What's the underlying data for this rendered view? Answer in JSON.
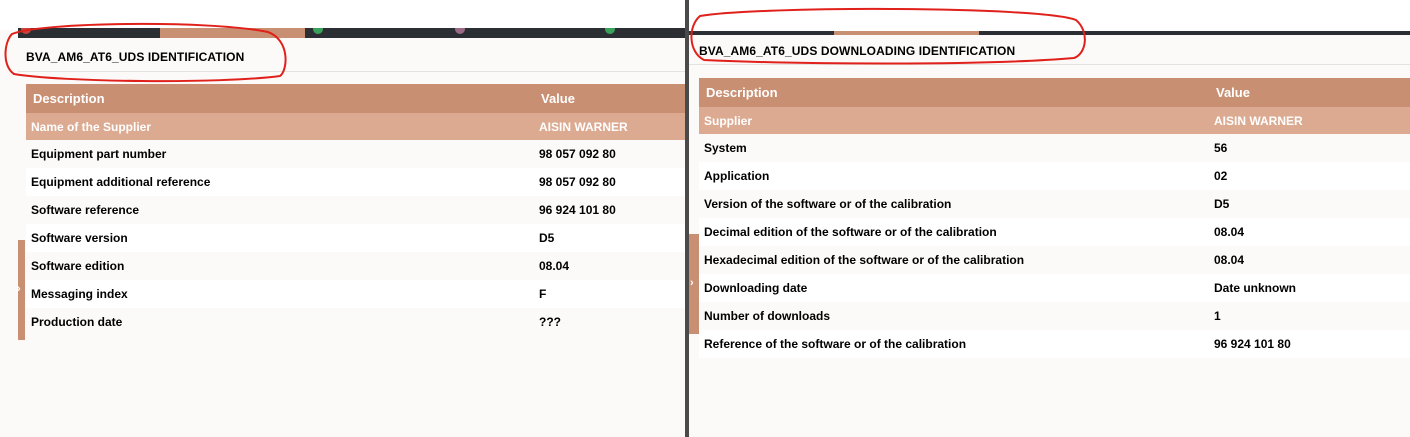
{
  "colors": {
    "header": "#c98f73",
    "first_row": "#dcaa91",
    "tab_bar": "#2b2f33",
    "annotation": "#e0201a"
  },
  "left_panel": {
    "title": "BVA_AM6_AT6_UDS IDENTIFICATION",
    "columns": [
      "Description",
      "Value"
    ],
    "rows": [
      [
        "Name of the Supplier",
        "AISIN WARNER"
      ],
      [
        "Equipment part number",
        "98 057 092 80"
      ],
      [
        "Equipment additional reference",
        "98 057 092 80"
      ],
      [
        "Software reference",
        "96 924 101 80"
      ],
      [
        "Software version",
        "D5"
      ],
      [
        "Software edition",
        "08.04"
      ],
      [
        "Messaging index",
        "F"
      ],
      [
        "Production date",
        "???"
      ]
    ],
    "handle_icon": "chevron-right-icon"
  },
  "right_panel": {
    "title": "BVA_AM6_AT6_UDS DOWNLOADING IDENTIFICATION",
    "columns": [
      "Description",
      "Value"
    ],
    "rows": [
      [
        "Supplier",
        "AISIN WARNER"
      ],
      [
        "System",
        "56"
      ],
      [
        "Application",
        "02"
      ],
      [
        "Version of the software or of the calibration",
        "D5"
      ],
      [
        "Decimal edition of the software or of the calibration",
        "08.04"
      ],
      [
        "Hexadecimal edition of the software or of the calibration",
        "08.04"
      ],
      [
        "Downloading date",
        "Date unknown"
      ],
      [
        "Number of downloads",
        "1"
      ],
      [
        "Reference of the software or of the calibration",
        "96 924 101 80"
      ]
    ],
    "handle_icon": "chevron-right-icon"
  }
}
